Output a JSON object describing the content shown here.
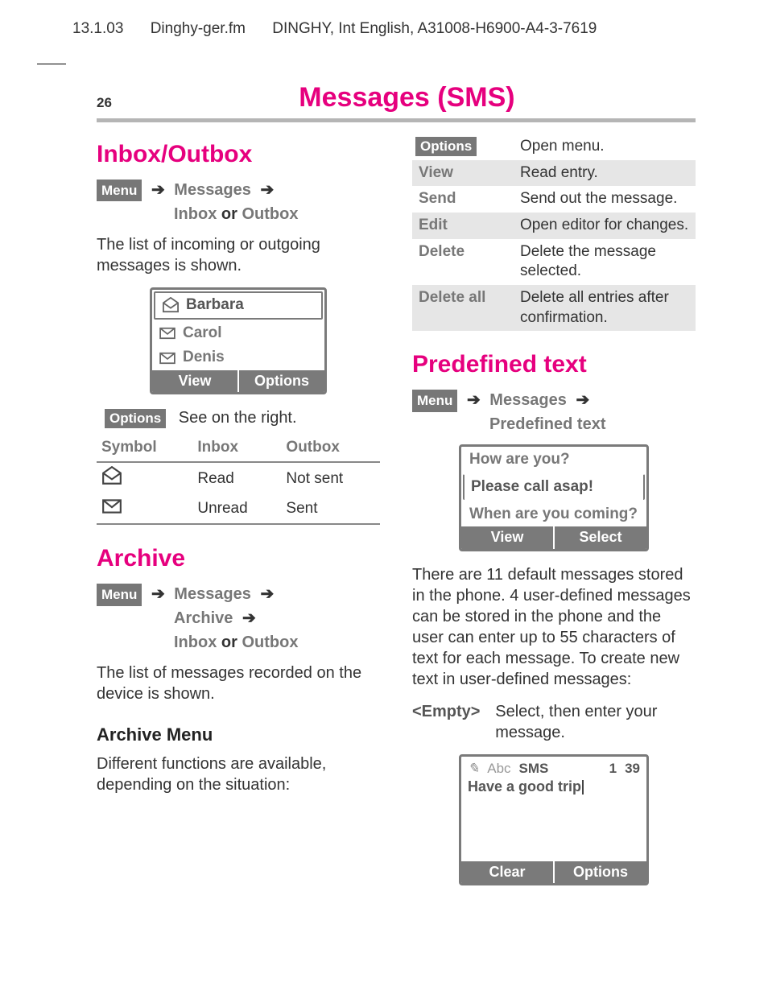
{
  "meta_header": {
    "date": "13.1.03",
    "file": "Dinghy-ger.fm",
    "doc": "DINGHY, Int English, A31008-H6900-A4-3-7619"
  },
  "page_number": "26",
  "page_title": "Messages (SMS)",
  "inbox_outbox": {
    "heading": "Inbox/Outbox",
    "path_menu": "Menu",
    "path_messages": "Messages",
    "path_trail": "Inbox or Outbox",
    "intro": "The list of incoming or outgoing messages is shown.",
    "box": {
      "rows": [
        "Barbara",
        "Carol",
        "Denis"
      ],
      "soft_left": "View",
      "soft_right": "Options"
    },
    "options_chip": "Options",
    "options_note": "See on the right.",
    "symbol_table": {
      "head": [
        "Symbol",
        "Inbox",
        "Outbox"
      ],
      "rows": [
        {
          "icon": "open",
          "inbox": "Read",
          "outbox": "Not sent"
        },
        {
          "icon": "closed",
          "inbox": "Unread",
          "outbox": "Sent"
        }
      ]
    }
  },
  "archive": {
    "heading": "Archive",
    "path_menu": "Menu",
    "path_messages": "Messages",
    "path_archive": "Archive",
    "path_trail": "Inbox or Outbox",
    "intro": "The list of messages recorded on the device is shown.",
    "sub_heading": "Archive Menu",
    "sub_intro": "Different functions are available, depending on the situation:"
  },
  "options_table": {
    "menu_chip": "Options",
    "menu_desc": "Open menu.",
    "rows": [
      {
        "k": "View",
        "v": "Read entry."
      },
      {
        "k": "Send",
        "v": "Send out the message."
      },
      {
        "k": "Edit",
        "v": "Open editor for changes."
      },
      {
        "k": "Delete",
        "v": "Delete the message selected."
      },
      {
        "k": "Delete all",
        "v": "Delete all entries after confirmation."
      }
    ]
  },
  "predefined": {
    "heading": "Predefined text",
    "path_menu": "Menu",
    "path_messages": "Messages",
    "path_trail": "Predefined text",
    "box": {
      "rows": [
        "How are you?",
        "Please call asap!",
        "When are you coming?"
      ],
      "soft_left": "View",
      "soft_right": "Select"
    },
    "para": "There are 11 default messages stored in the phone. 4 user-defined messages can be stored in the phone and the user can enter up to 55 characters of text for each message. To create new text in user-defined messages:",
    "empty_key": "<Empty>",
    "empty_desc": "Select, then enter your message.",
    "editor": {
      "mode_prefix_script": "✉",
      "mode_prefix": "Abc",
      "mode_bold": "SMS",
      "num_a": "1",
      "num_b": "39",
      "text": "Have a good trip",
      "soft_left": "Clear",
      "soft_right": "Options"
    }
  }
}
